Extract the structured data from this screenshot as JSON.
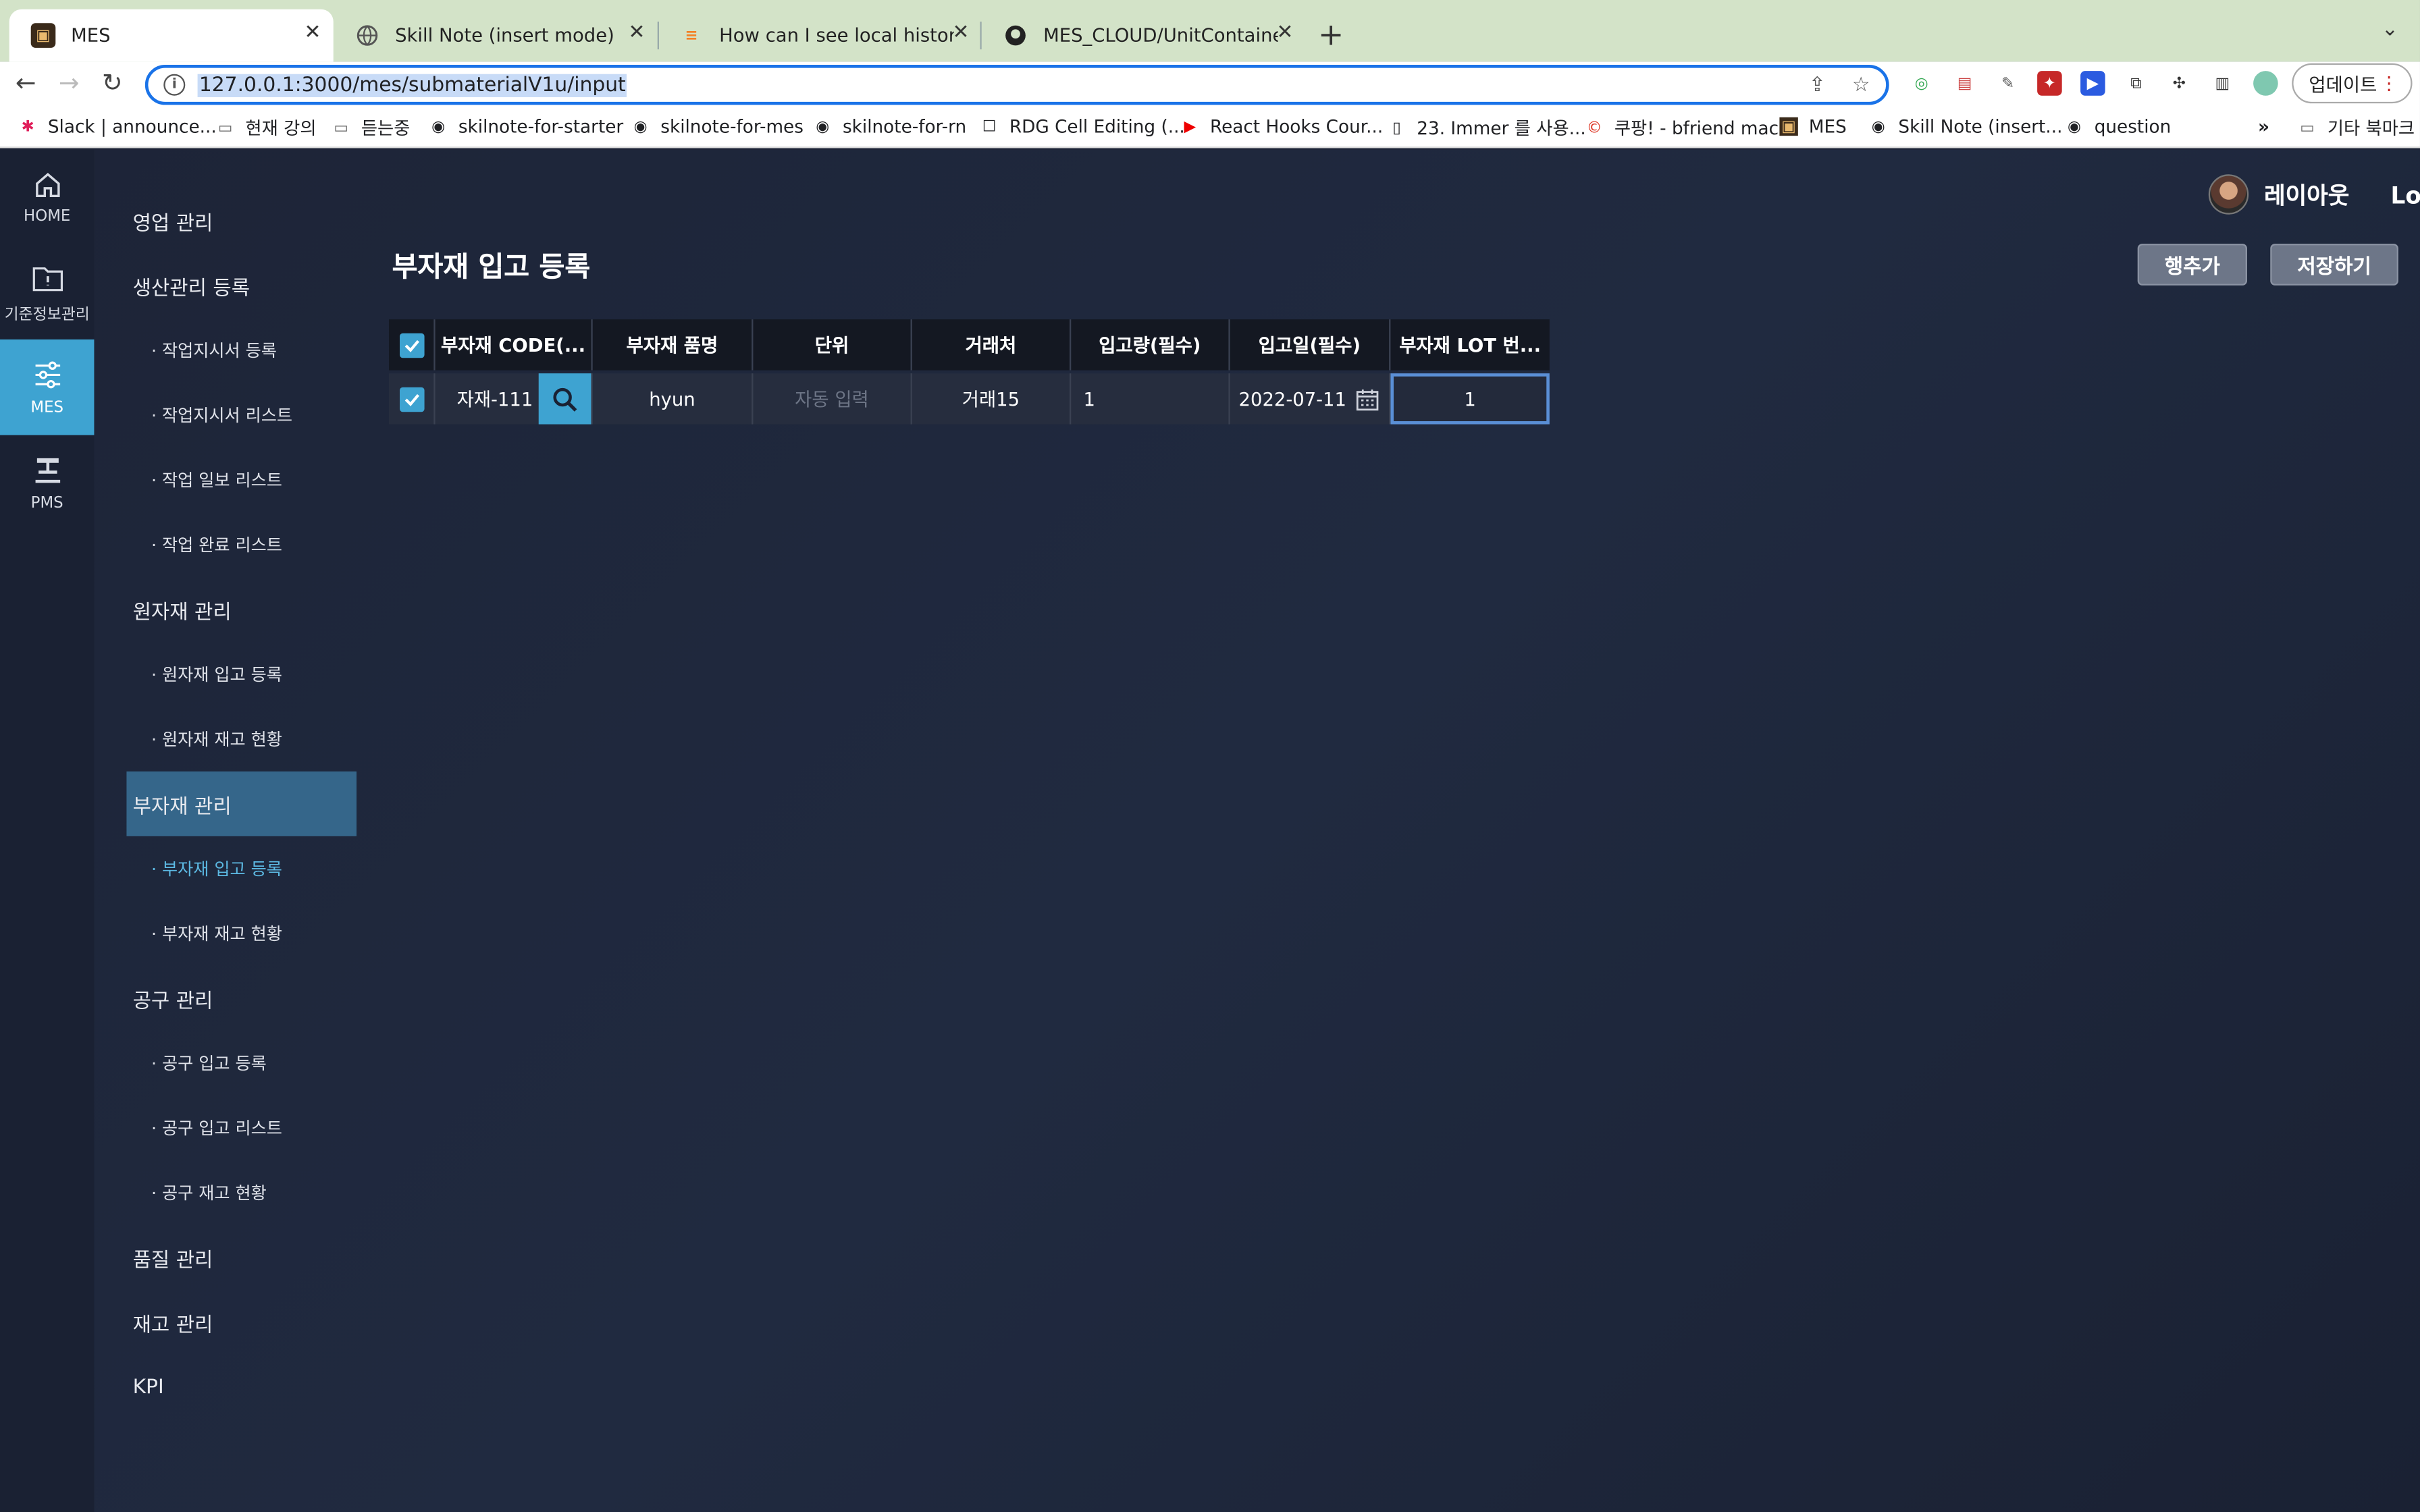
{
  "browser": {
    "tabs": [
      {
        "title": "MES",
        "favicon": "mes-logo-icon",
        "active": true
      },
      {
        "title": "Skill Note (insert mode)",
        "favicon": "globe-icon"
      },
      {
        "title": "How can I see local history cha",
        "favicon": "stackoverflow-icon"
      },
      {
        "title": "MES_CLOUD/UnitContainer.tsx",
        "favicon": "github-icon"
      }
    ],
    "url": "127.0.0.1:3000/mes/submaterialV1u/input",
    "update_label": "업데이트",
    "bookmarks": [
      {
        "label": "Slack | announce...",
        "icon": "slack-icon"
      },
      {
        "label": "현재 강의",
        "icon": "folder-icon"
      },
      {
        "label": "듣는중",
        "icon": "folder-icon"
      },
      {
        "label": "skilnote-for-starter",
        "icon": "globe-icon"
      },
      {
        "label": "skilnote-for-mes",
        "icon": "globe-icon"
      },
      {
        "label": "skilnote-for-rn",
        "icon": "globe-icon"
      },
      {
        "label": "RDG Cell Editing (...",
        "icon": "page-icon"
      },
      {
        "label": "React Hooks Cour...",
        "icon": "youtube-icon"
      },
      {
        "label": "23. Immer 를 사용...",
        "icon": "book-icon"
      },
      {
        "label": "쿠팡! - bfriend mac",
        "icon": "coupang-icon"
      },
      {
        "label": "MES",
        "icon": "mes-logo-icon"
      },
      {
        "label": "Skill Note (insert...",
        "icon": "globe-icon"
      },
      {
        "label": "question",
        "icon": "globe-icon"
      }
    ],
    "bookmarks_more": "»",
    "other_bookmarks": "기타 북마크"
  },
  "rail": [
    {
      "label": "HOME",
      "icon": "home-icon"
    },
    {
      "label": "기준정보관리",
      "icon": "info-folder-icon"
    },
    {
      "label": "MES",
      "icon": "sliders-icon",
      "active": true
    },
    {
      "label": "PMS",
      "icon": "press-icon"
    }
  ],
  "menu": [
    {
      "label": "영업 관리",
      "type": "group"
    },
    {
      "label": "생산관리 등록",
      "type": "group"
    },
    {
      "label": "· 작업지시서 등록",
      "type": "sub"
    },
    {
      "label": "· 작업지시서 리스트",
      "type": "sub"
    },
    {
      "label": "· 작업 일보 리스트",
      "type": "sub"
    },
    {
      "label": "· 작업 완료 리스트",
      "type": "sub"
    },
    {
      "label": "원자재 관리",
      "type": "group"
    },
    {
      "label": "· 원자재 입고 등록",
      "type": "sub"
    },
    {
      "label": "· 원자재 재고 현황",
      "type": "sub"
    },
    {
      "label": "부자재 관리",
      "type": "group",
      "active": true
    },
    {
      "label": "· 부자재 입고 등록",
      "type": "sub",
      "current": true
    },
    {
      "label": "· 부자재 재고 현황",
      "type": "sub"
    },
    {
      "label": "공구 관리",
      "type": "group"
    },
    {
      "label": "· 공구 입고 등록",
      "type": "sub"
    },
    {
      "label": "· 공구 입고 리스트",
      "type": "sub"
    },
    {
      "label": "· 공구 재고 현황",
      "type": "sub"
    },
    {
      "label": "품질 관리",
      "type": "group"
    },
    {
      "label": "재고 관리",
      "type": "group"
    },
    {
      "label": "KPI",
      "type": "group"
    }
  ],
  "header": {
    "user_name": "레이아웃",
    "logout": "Lo",
    "page_title": "부자재 입고 등록",
    "add_row": "행추가",
    "save": "저장하기"
  },
  "grid": {
    "columns": [
      "부자재 CODE(...",
      "부자재 품명",
      "단위",
      "거래처",
      "입고량(필수)",
      "입고일(필수)",
      "부자재 LOT 번..."
    ],
    "rows": [
      {
        "checked": true,
        "code": "자재-111",
        "name": "hyun",
        "unit_placeholder": "자동 입력",
        "customer": "거래15",
        "quantity": "1",
        "date": "2022-07-11",
        "lot": "1"
      }
    ]
  },
  "colors": {
    "accent": "#3ea3d1",
    "menu_active": "#35668a",
    "background": "#1b2235"
  }
}
